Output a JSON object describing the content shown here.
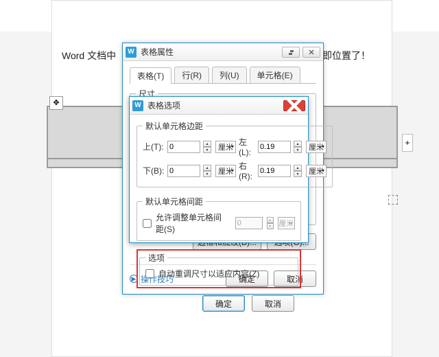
{
  "bg": {
    "text_left": "Word 文档中",
    "text_right": "即位置了！"
  },
  "dlg1": {
    "title": "表格属性",
    "tabs": [
      "表格(T)",
      "行(R)",
      "列(U)",
      "单元格(E)"
    ],
    "fs_size_label": "尺寸",
    "btn_border": "边框和底纹(B)...",
    "btn_options": "选项(O)...",
    "link_tips": "操作技巧",
    "ok": "确定",
    "cancel": "取消"
  },
  "dlg2": {
    "title": "表格选项",
    "fs_margins": "默认单元格边距",
    "lbl_top": "上(T):",
    "lbl_bottom": "下(B):",
    "lbl_left": "左(L):",
    "lbl_right": "右(R):",
    "val_top": "0",
    "val_bottom": "0",
    "val_left": "0.19",
    "val_right": "0.19",
    "unit": "厘米",
    "fs_spacing": "默认单元格间距",
    "cb_spacing": "允许调整单元格间距(S)",
    "val_spacing": "0",
    "fs_opts": "选项",
    "cb_autofit": "自动重调尺寸以适应内容(Z)",
    "ok": "确定",
    "cancel": "取消"
  }
}
